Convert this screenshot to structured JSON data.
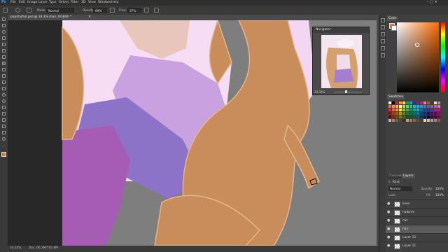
{
  "app": {
    "logo": "Ps"
  },
  "menu": [
    "File",
    "Edit",
    "Image",
    "Layer",
    "Type",
    "Select",
    "Filter",
    "3D",
    "View",
    "Window",
    "Help"
  ],
  "options_bar": {
    "mode_label": "Mode:",
    "mode_value": "Normal",
    "opacity_label": "Opacity:",
    "opacity_value": "69%",
    "flow_label": "Flow:",
    "flow_value": "37%"
  },
  "document": {
    "tab_title": "popstarhol.psd @ 33.3% (hair, RGB/8) *",
    "close": "×"
  },
  "status": {
    "zoom": "33.33%",
    "doc_size": "Doc: 66.2M/745.8M"
  },
  "navigator": {
    "title": "Navigator",
    "zoom": "33.33%"
  },
  "color_panel": {
    "title": "Color"
  },
  "swatches_panel": {
    "title": "Swatches",
    "colors": [
      "#ffffff",
      "#000000",
      "#ed1c24",
      "#f7941d",
      "#fff200",
      "#00a651",
      "#00aeef",
      "#2e3192",
      "#662d91",
      "#ec008c",
      "#c69c6d",
      "#8c6239",
      "#603913",
      "#ddd",
      "#999",
      "#f26c4f",
      "#f68e56",
      "#fbaf5d",
      "#fff799",
      "#acd372",
      "#7cc576",
      "#3bb878",
      "#1abbb4",
      "#00bff3",
      "#438cca",
      "#5574b9",
      "#605ca8",
      "#855fa8",
      "#a763a8",
      "#f06ea9",
      "#ed1c24",
      "#f26522",
      "#f7941d",
      "#fff200",
      "#8dc63f",
      "#39b54a",
      "#00a651",
      "#00a99d",
      "#00aeef",
      "#0072bc",
      "#0054a6",
      "#2e3192",
      "#662d91",
      "#92278f",
      "#ec008c",
      "#9e0b0f",
      "#a0410d",
      "#a36209",
      "#aba000",
      "#598527",
      "#1a7b30",
      "#007236",
      "#00746b",
      "#0076a3",
      "#004b80",
      "#003471",
      "#1b1464",
      "#440e62",
      "#630460",
      "#9e005d",
      "#790000",
      "#7b2e00",
      "#7d4900",
      "#827b00",
      "#406618",
      "#005e20",
      "#005826",
      "#005952",
      "#005b7f",
      "#003663",
      "#002157",
      "#0d004c",
      "#32004b",
      "#4b0049",
      "#7b0046",
      "#c7b299",
      "#998675",
      "#736357",
      "#534741",
      "#37302a",
      "#c69c6d",
      "#a67c52",
      "#8c6239",
      "#754c24",
      "#603913",
      "#e8d5c0",
      "#d8b89a",
      "#c49a7a",
      "#b07e5e",
      "#8d5f44"
    ]
  },
  "layers_panel": {
    "tab_channels": "Channels",
    "tab_layers": "Layers",
    "kind_label": "Kind",
    "blend_mode": "Normal",
    "opacity_label": "Opacity:",
    "opacity_value": "100%",
    "lock_label": "Lock:",
    "fill_label": "Fill:",
    "fill_value": "100%",
    "layers": [
      {
        "name": "lines"
      },
      {
        "name": "hatbrim"
      },
      {
        "name": "hat"
      },
      {
        "name": "hair",
        "active": true
      },
      {
        "name": "Layer 12"
      },
      {
        "name": "Layer 11"
      }
    ]
  },
  "colors": {
    "ui_dark": "#282828",
    "panel": "#404040",
    "foreground_color": "#e07a3a",
    "background_color": "#ffffff"
  }
}
